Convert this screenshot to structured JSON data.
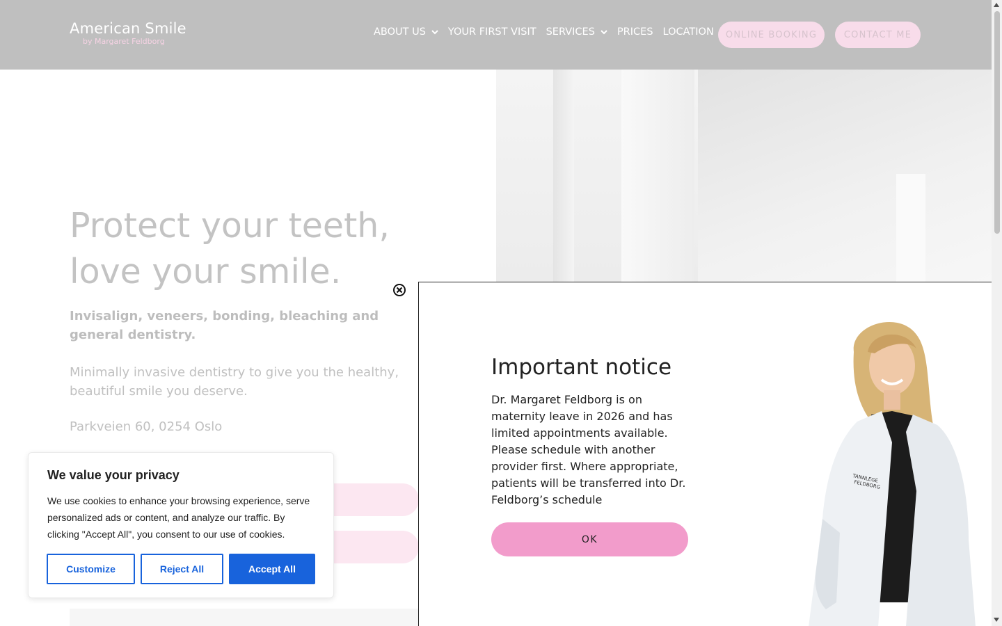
{
  "header": {
    "logo_main": "American Smile",
    "logo_sub": "by Margaret Feldborg",
    "nav": [
      {
        "label": "ABOUT US",
        "has_dropdown": true
      },
      {
        "label": "YOUR FIRST VISIT",
        "has_dropdown": false
      },
      {
        "label": "SERVICES",
        "has_dropdown": true
      },
      {
        "label": "PRICES",
        "has_dropdown": false
      },
      {
        "label": "LOCATION",
        "has_dropdown": false
      }
    ],
    "booking_button": "ONLINE BOOKING",
    "contact_button": "CONTACT ME"
  },
  "hero": {
    "title_line1": "Protect your teeth,",
    "title_line2": "love your smile.",
    "subtitle": "Invisalign, veneers, bonding, bleaching and general dentistry.",
    "text": "Minimally invasive dentistry to give you the healthy, beautiful smile you deserve.",
    "address": "Parkveien 60, 0254 Oslo"
  },
  "modal": {
    "title": "Important notice",
    "body": "Dr. Margaret Feldborg is on maternity leave in 2026 and has limited appointments available. Please schedule with another provider first. Where appropriate, patients will be transferred into Dr. Feldborg’s schedule",
    "ok_label": "OK",
    "coat_text_line1": "TANNLEGE",
    "coat_text_line2": "FELDBORG"
  },
  "cookie": {
    "title": "We value your privacy",
    "text": "We use cookies to enhance your browsing experience, serve personalized ads or content, and analyze our traffic. By clicking \"Accept All\", you consent to our use of cookies.",
    "customize": "Customize",
    "reject": "Reject All",
    "accept": "Accept All"
  },
  "colors": {
    "header_bg": "#bfbfbf",
    "pink_pill": "#f8dcea",
    "ok_button": "#f29ccb",
    "cookie_blue": "#1863dc"
  }
}
